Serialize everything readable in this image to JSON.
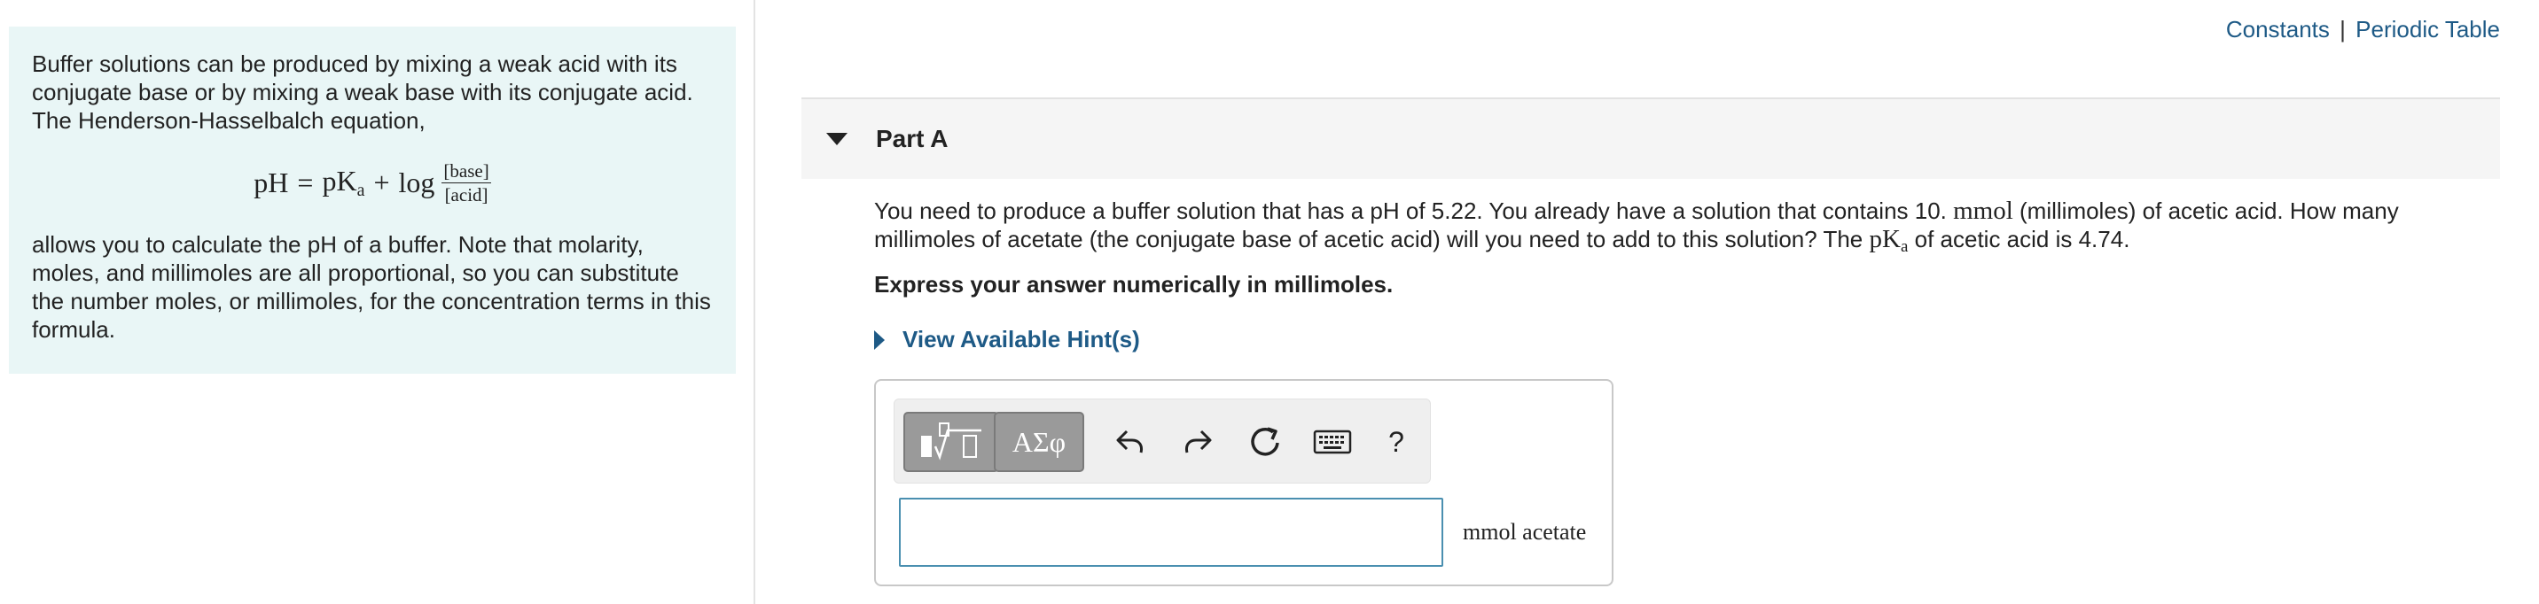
{
  "header": {
    "links": [
      "Constants",
      "Periodic Table"
    ],
    "separator": "|"
  },
  "info_panel": {
    "intro": "Buffer solutions can be produced by mixing a weak acid with its conjugate base or by mixing a weak base with its conjugate acid. The Henderson-Hasselbalch equation,",
    "equation": {
      "lhs": "pH",
      "equals": "=",
      "pK": "pK",
      "pK_sub": "a",
      "plus": "+",
      "log": "log",
      "numerator": "[base]",
      "denominator": "[acid]"
    },
    "after": "allows you to calculate the pH of a buffer. Note that molarity, moles, and millimoles are all proportional, so you can substitute the number moles, or millimoles, for the concentration terms in this formula."
  },
  "part": {
    "title": "Part A",
    "question_pre": "You need to produce a buffer solution that has a pH of 5.22. You already have a solution that contains 10. ",
    "question_unit": "mmol",
    "question_mid": " (millimoles) of acetic acid. How many millimoles of acetate (the conjugate base of acetic acid) will you need to add to this solution? The ",
    "question_pk": "pK",
    "question_pk_sub": "a",
    "question_post": " of acetic acid is 4.74.",
    "instruction": "Express your answer numerically in millimoles.",
    "hint_label": "View Available Hint(s)"
  },
  "answer": {
    "symbols_label": "ΑΣφ",
    "help_label": "?",
    "input_value": "",
    "unit": "mmol acetate"
  },
  "colors": {
    "panel_bg": "#e9f6f6",
    "link": "#1e5a86",
    "input_border": "#4a8fb0"
  }
}
